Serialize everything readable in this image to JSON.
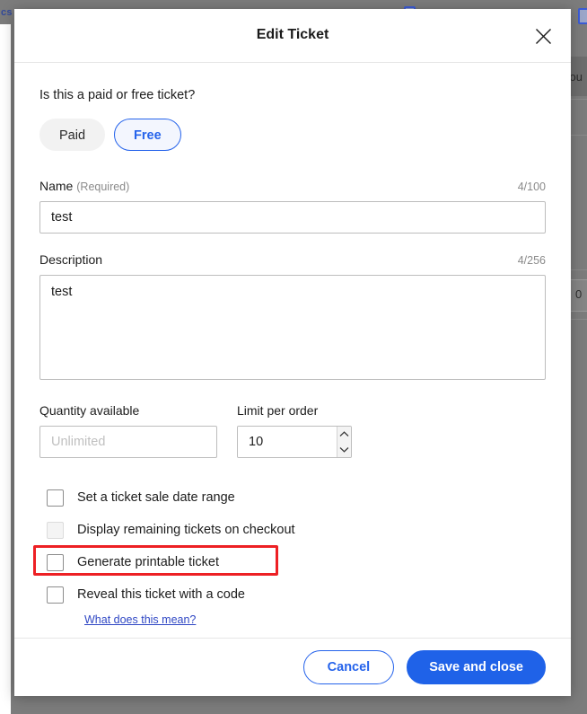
{
  "background": {
    "breadcrumb_fragment": "cs",
    "checkout_fragment": "kou",
    "cell_value_fragment": "0"
  },
  "modal": {
    "title": "Edit Ticket",
    "close_label": "✕",
    "pricing_question": "Is this a paid or free ticket?",
    "pricing_options": [
      {
        "label": "Paid",
        "selected": false
      },
      {
        "label": "Free",
        "selected": true
      }
    ],
    "name_field": {
      "label": "Name",
      "required_note": "(Required)",
      "counter": "4/100",
      "value": "test",
      "placeholder": ""
    },
    "description_field": {
      "label": "Description",
      "counter": "4/256",
      "value": "test",
      "placeholder": ""
    },
    "quantity_field": {
      "label": "Quantity available",
      "value": "",
      "placeholder": "Unlimited"
    },
    "limit_field": {
      "label": "Limit per order",
      "value": "10",
      "placeholder": ""
    },
    "checkboxes": [
      {
        "label": "Set a ticket sale date range",
        "checked": false,
        "disabled": false,
        "highlighted": false
      },
      {
        "label": "Display remaining tickets on checkout",
        "checked": false,
        "disabled": true,
        "highlighted": false
      },
      {
        "label": "Generate printable ticket",
        "checked": false,
        "disabled": false,
        "highlighted": true
      },
      {
        "label": "Reveal this ticket with a code",
        "checked": false,
        "disabled": false,
        "highlighted": false
      }
    ],
    "help_link": "What does this mean?",
    "footer": {
      "cancel_label": "Cancel",
      "save_label": "Save and close"
    }
  },
  "colors": {
    "accent_blue": "#2563eb",
    "primary_button": "#1f62e8",
    "highlight_red": "#ed2024",
    "link_blue": "#2f47c4"
  }
}
